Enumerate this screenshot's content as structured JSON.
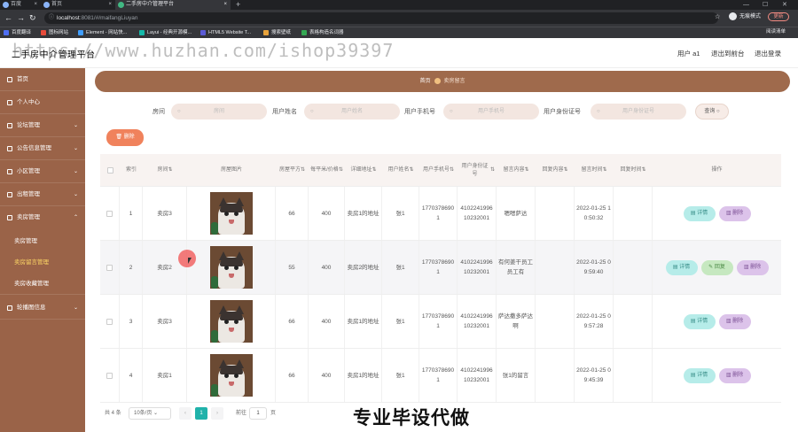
{
  "browser": {
    "tabs": [
      {
        "label": "百度",
        "active": false
      },
      {
        "label": "首页",
        "active": false
      },
      {
        "label": "二手房中介管理平台",
        "active": true
      }
    ],
    "url_host": "localhost",
    "url_path": ":8081/#/maifangLiuyan",
    "profile_label": "无痕模式",
    "update_label": "更新",
    "reading_list": "阅读清单",
    "bookmarks": [
      "百度翻译",
      "图标网站",
      "Element - 网站快...",
      "Layui - 经典开源模...",
      "HTML5 Website T...",
      "搜索壁纸",
      "表格构造名词器"
    ]
  },
  "header": {
    "title": "二手房中介管理平台",
    "watermark": "https://www.huzhan.com/ishop39397",
    "user_label": "用户 a1",
    "exit_front_label": "退出到前台",
    "logout_label": "退出登录"
  },
  "sidebar": {
    "items": [
      {
        "label": "首页"
      },
      {
        "label": "个人中心"
      },
      {
        "label": "论坛管理"
      },
      {
        "label": "公告信息管理"
      },
      {
        "label": "小区管理"
      },
      {
        "label": "出租管理"
      },
      {
        "label": "卖房管理"
      }
    ],
    "sub_items": [
      {
        "label": "卖房管理"
      },
      {
        "label": "卖房留言管理"
      },
      {
        "label": "卖房收藏管理"
      }
    ],
    "last_item": {
      "label": "轮播图信息"
    }
  },
  "breadcrumb": {
    "home": "首页",
    "current": "卖房留言"
  },
  "search": {
    "fields": [
      {
        "label": "房间",
        "placeholder": "房间"
      },
      {
        "label": "用户姓名",
        "placeholder": "用户姓名"
      },
      {
        "label": "用户手机号",
        "placeholder": "用户手机号"
      },
      {
        "label": "用户身份证号",
        "placeholder": "用户身份证号"
      }
    ],
    "button": "查询"
  },
  "batch_delete_label": "删除",
  "table": {
    "headers": [
      "索引",
      "房间",
      "房屋图片",
      "房屋平方",
      "每平米/价格",
      "详细地址",
      "用户姓名",
      "用户手机号",
      "用户身份证号",
      "留言内容",
      "回复内容",
      "留言时间",
      "回复时间",
      "操作"
    ],
    "rows": [
      {
        "index": "1",
        "room": "卖房3",
        "area": "66",
        "price": "400",
        "address": "卖房1的地址",
        "name": "张1",
        "phone": "17703786901",
        "idcard": "410224199610232001",
        "message": "嗯嗯萨达",
        "reply": "",
        "msg_time": "2022-01-25 10:50:32",
        "reply_time": "",
        "has_reply_btn": false
      },
      {
        "index": "2",
        "room": "卖房2",
        "area": "55",
        "price": "400",
        "address": "卖房2的地址",
        "name": "张1",
        "phone": "17703786901",
        "idcard": "410224199610232001",
        "message": "有何姜干员工员工有",
        "reply": "",
        "msg_time": "2022-01-25 09:59:40",
        "reply_time": "",
        "has_reply_btn": true
      },
      {
        "index": "3",
        "room": "卖房3",
        "area": "66",
        "price": "400",
        "address": "卖房1的地址",
        "name": "张1",
        "phone": "17703786901",
        "idcard": "410224199610232001",
        "message": "萨达撒多萨达啊",
        "reply": "",
        "msg_time": "2022-01-25 09:57:28",
        "reply_time": "",
        "has_reply_btn": false
      },
      {
        "index": "4",
        "room": "卖房1",
        "area": "66",
        "price": "400",
        "address": "卖房1的地址",
        "name": "张1",
        "phone": "17703786901",
        "idcard": "410224199610232001",
        "message": "张1的留言",
        "reply": "",
        "msg_time": "2022-01-25 09:45:39",
        "reply_time": "",
        "has_reply_btn": false
      }
    ],
    "op_detail": "详情",
    "op_reply": "回复",
    "op_delete": "删除"
  },
  "pagination": {
    "total": "共 4 条",
    "page_size": "10条/页",
    "current_page": "1",
    "goto_label": "前往",
    "goto_value": "1",
    "page_unit": "页"
  },
  "banner": "专业毕设代做"
}
